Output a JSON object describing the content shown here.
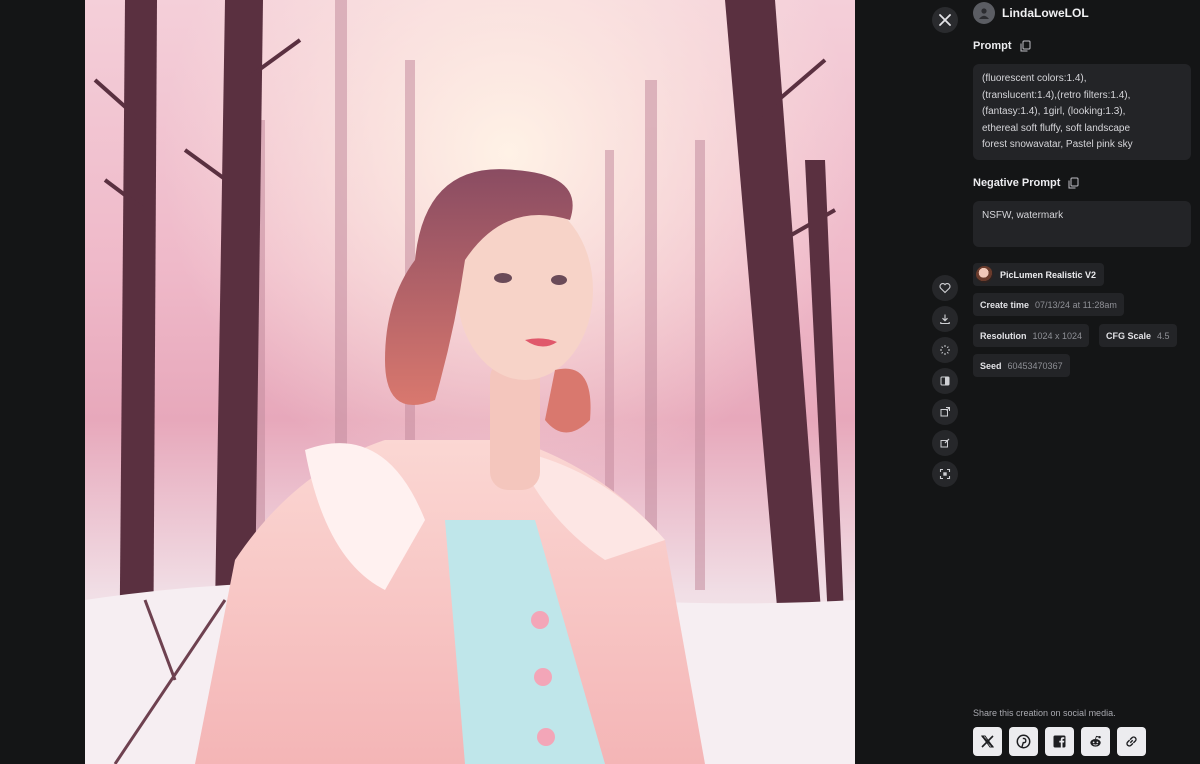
{
  "user": {
    "name": "LindaLoweLOL"
  },
  "prompt": {
    "label": "Prompt",
    "lines": [
      "(fluorescent colors:1.4),",
      "(translucent:1.4),(retro filters:1.4),",
      "(fantasy:1.4), 1girl, (looking:1.3),",
      "ethereal soft fluffy, soft landscape",
      "forest snowavatar, Pastel pink sky"
    ]
  },
  "negative_prompt": {
    "label": "Negative Prompt",
    "text": "NSFW, watermark"
  },
  "model": {
    "name": "PicLumen Realistic V2"
  },
  "meta": {
    "create_time": {
      "label": "Create time",
      "value": "07/13/24 at 11:28am"
    },
    "resolution": {
      "label": "Resolution",
      "value": "1024 x 1024"
    },
    "cfg_scale": {
      "label": "CFG Scale",
      "value": "4.5"
    },
    "seed": {
      "label": "Seed",
      "value": "60453470367"
    }
  },
  "share": {
    "text": "Share this creation on social media.",
    "buttons": [
      "x-icon",
      "pinterest-icon",
      "facebook-icon",
      "reddit-icon",
      "link-icon"
    ]
  },
  "rail_actions": [
    "heart-icon",
    "download-icon",
    "sparkle-icon",
    "compare-icon",
    "upscale-icon",
    "edit-icon",
    "expand-icon"
  ],
  "colors": {
    "background": "#141516",
    "panel_box": "#232427",
    "sky_pink": "#efb9c9",
    "coat_pink": "#f6c5c6",
    "dress_mint": "#bfe6ea"
  }
}
